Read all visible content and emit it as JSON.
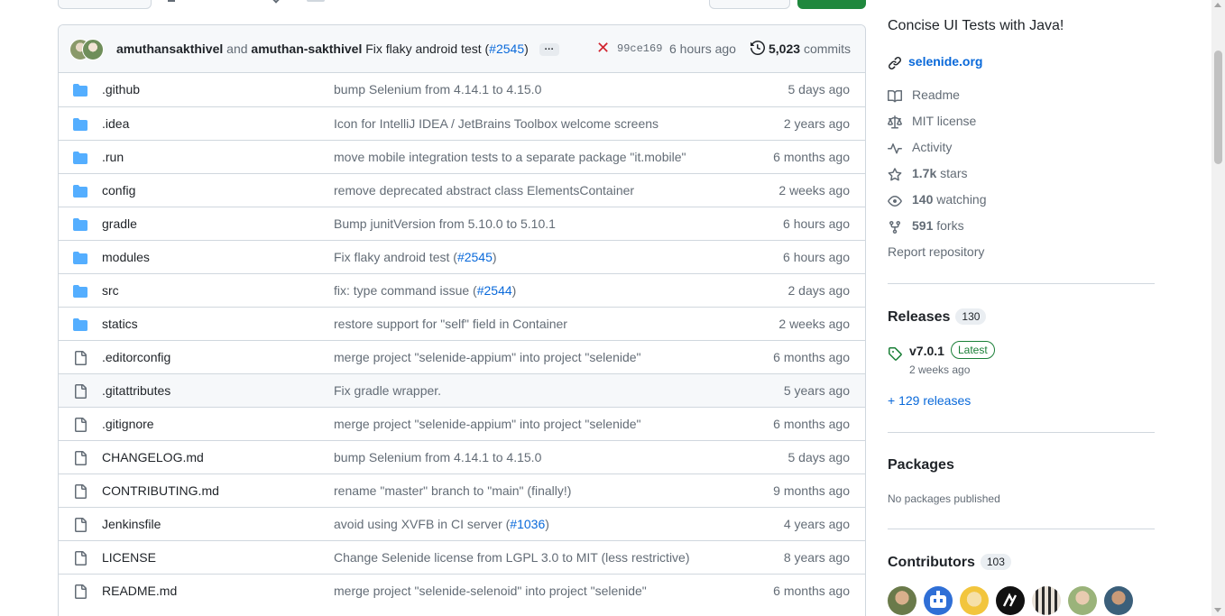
{
  "latest_commit": {
    "author1": "amuthansakthivel",
    "conjunction": "and",
    "author2": "amuthan-sakthivel",
    "message_prefix": "Fix flaky android test (",
    "message_pr": "#2545",
    "message_suffix": ")",
    "ellipsis": "…",
    "status": "failure",
    "sha": "99ce169",
    "time": "6 hours ago",
    "commit_count": "5,023",
    "commits_label": "commits"
  },
  "files": [
    {
      "name": ".github",
      "type": "folder",
      "msg": "bump Selenium from 4.14.1 to 4.15.0",
      "pr": "",
      "time": "5 days ago"
    },
    {
      "name": ".idea",
      "type": "folder",
      "msg": "Icon for IntelliJ IDEA / JetBrains Toolbox welcome screens",
      "pr": "",
      "time": "2 years ago"
    },
    {
      "name": ".run",
      "type": "folder",
      "msg": "move mobile integration tests to a separate package \"it.mobile\"",
      "pr": "",
      "time": "6 months ago"
    },
    {
      "name": "config",
      "type": "folder",
      "msg": "remove deprecated abstract class ElementsContainer",
      "pr": "",
      "time": "2 weeks ago"
    },
    {
      "name": "gradle",
      "type": "folder",
      "msg": "Bump junitVersion from 5.10.0 to 5.10.1",
      "pr": "",
      "time": "6 hours ago"
    },
    {
      "name": "modules",
      "type": "folder",
      "msg": "Fix flaky android test (",
      "pr": "#2545",
      "time": "6 hours ago"
    },
    {
      "name": "src",
      "type": "folder",
      "msg": "fix: type command issue (",
      "pr": "#2544",
      "time": "2 days ago"
    },
    {
      "name": "statics",
      "type": "folder",
      "msg": "restore support for \"self\" field in Container",
      "pr": "",
      "time": "2 weeks ago"
    },
    {
      "name": ".editorconfig",
      "type": "file",
      "msg": "merge project \"selenide-appium\" into project \"selenide\"",
      "pr": "",
      "time": "6 months ago"
    },
    {
      "name": ".gitattributes",
      "type": "file",
      "msg": "Fix gradle wrapper.",
      "pr": "",
      "time": "5 years ago"
    },
    {
      "name": ".gitignore",
      "type": "file",
      "msg": "merge project \"selenide-appium\" into project \"selenide\"",
      "pr": "",
      "time": "6 months ago"
    },
    {
      "name": "CHANGELOG.md",
      "type": "file",
      "msg": "bump Selenium from 4.14.1 to 4.15.0",
      "pr": "",
      "time": "5 days ago"
    },
    {
      "name": "CONTRIBUTING.md",
      "type": "file",
      "msg": "rename \"master\" branch to \"main\" (finally!)",
      "pr": "",
      "time": "9 months ago"
    },
    {
      "name": "Jenkinsfile",
      "type": "file",
      "msg": "avoid using XVFB in CI server (",
      "pr": "#1036",
      "time": "4 years ago"
    },
    {
      "name": "LICENSE",
      "type": "file",
      "msg": "Change Selenide license from LGPL 3.0 to MIT (less restrictive)",
      "pr": "",
      "time": "8 years ago"
    },
    {
      "name": "README.md",
      "type": "file",
      "msg": "merge project \"selenide-selenoid\" into project \"selenide\"",
      "pr": "",
      "time": "6 months ago"
    }
  ],
  "sidebar": {
    "about": "Concise UI Tests with Java!",
    "website": "selenide.org",
    "readme": "Readme",
    "license": "MIT license",
    "activity": "Activity",
    "stars_count": "1.7k",
    "stars_label": "stars",
    "watching_count": "140",
    "watching_label": "watching",
    "forks_count": "591",
    "forks_label": "forks",
    "report": "Report repository",
    "releases_title": "Releases",
    "releases_count": "130",
    "release_version": "v7.0.1",
    "release_badge": "Latest",
    "release_date": "2 weeks ago",
    "more_releases": "+ 129 releases",
    "packages_title": "Packages",
    "packages_empty": "No packages published",
    "contributors_title": "Contributors",
    "contributors_count": "103"
  },
  "colors": {
    "link": "#0969da",
    "folder": "#54aeff",
    "failure": "#d1242f",
    "latest": "#1a7f37",
    "primary_button": "#1f883d"
  }
}
